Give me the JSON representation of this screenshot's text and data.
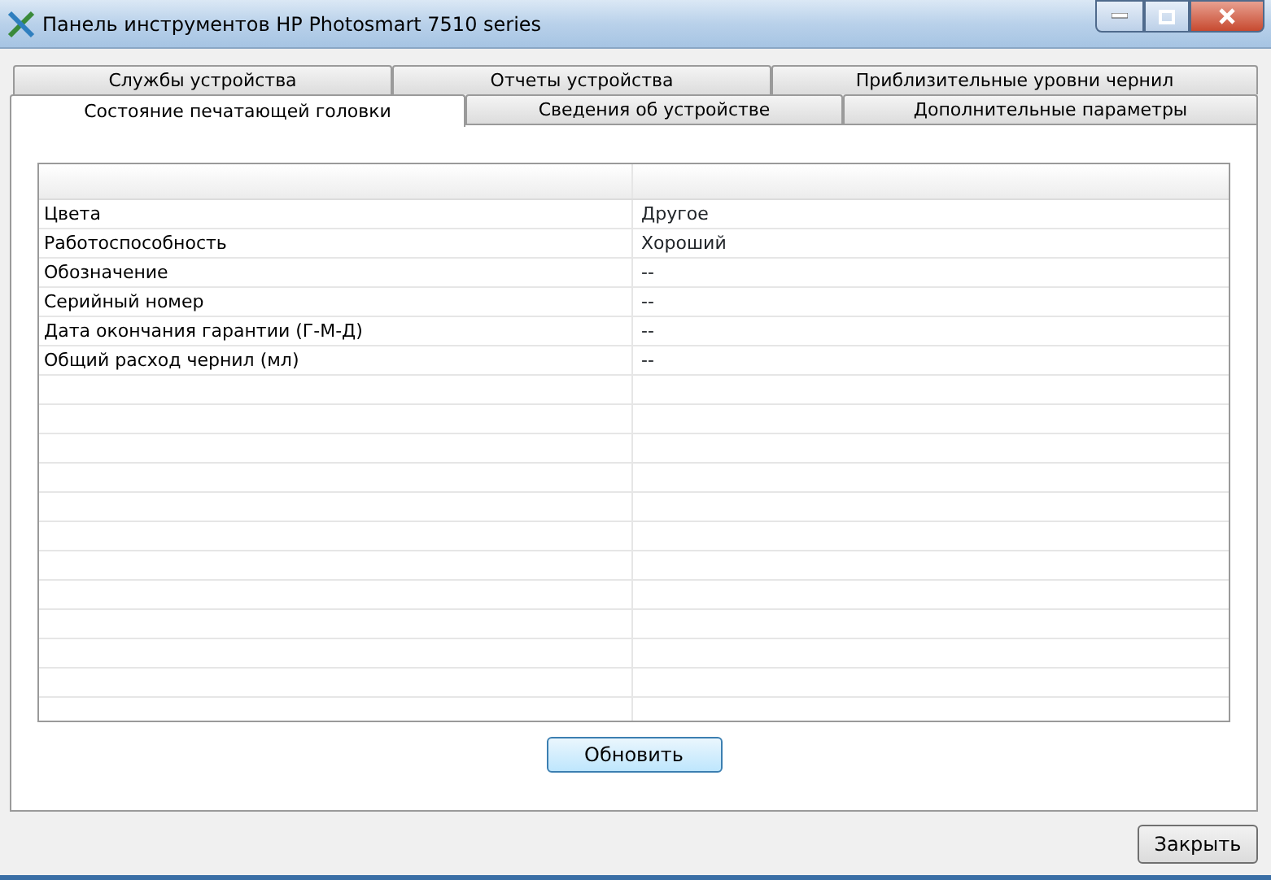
{
  "window": {
    "title": "Панель инструментов HP Photosmart 7510 series"
  },
  "tab_rows": [
    {
      "tabs": [
        {
          "label": "Службы устройства",
          "selected": false
        },
        {
          "label": "Отчеты устройства",
          "selected": false
        },
        {
          "label": "Приблизительные уровни чернил",
          "selected": false
        }
      ]
    },
    {
      "tabs": [
        {
          "label": "Состояние печатающей головки",
          "selected": true
        },
        {
          "label": "Сведения об устройстве",
          "selected": false
        },
        {
          "label": "Дополнительные параметры",
          "selected": false
        }
      ]
    }
  ],
  "table": {
    "rows": [
      {
        "property": "Цвета",
        "value": "Другое"
      },
      {
        "property": "Работоспособность",
        "value": "Хороший"
      },
      {
        "property": "Обозначение",
        "value": "--"
      },
      {
        "property": "Серийный номер",
        "value": "--"
      },
      {
        "property": "Дата окончания гарантии (Г-М-Д)",
        "value": "--"
      },
      {
        "property": "Общий расход чернил (мл)",
        "value": "--"
      }
    ]
  },
  "refresh_button": "Обновить",
  "close_button": "Закрыть"
}
